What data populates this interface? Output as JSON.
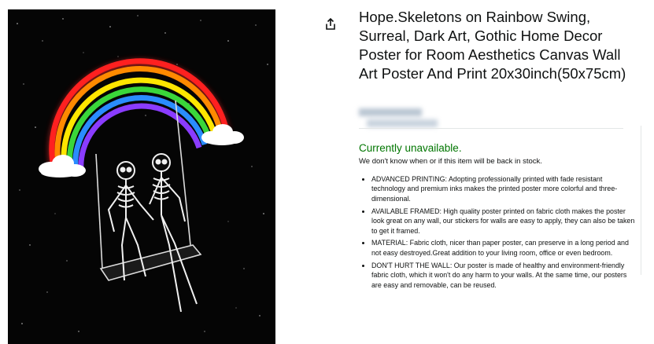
{
  "product": {
    "title": "Hope.Skeletons on Rainbow Swing, Surreal, Dark Art, Gothic Home Decor Poster for Room Aesthetics Canvas Wall Art Poster And Print 20x30inch(50x75cm)",
    "image_alt": "Skeletons on rainbow swing poster"
  },
  "share": {
    "icon": "share-icon"
  },
  "availability": {
    "status": "Currently unavailable.",
    "note": "We don't know when or if this item will be back in stock."
  },
  "features": [
    "ADVANCED PRINTING: Adopting professionally printed with fade resistant technology and premium inks makes the printed poster more colorful and three-dimensional.",
    "AVAILABLE FRAMED: High quality poster printed on fabric cloth makes the poster look great on any wall, our stickers for walls are easy to apply, they can also be taken to get it framed.",
    "MATERIAL: Fabric cloth, nicer than paper poster, can preserve in a long period and not easy destroyed.Great addition to your living room, office or even bedroom.",
    "DON'T HURT THE WALL: Our poster is made of healthy and environment-friendly fabric cloth, which it won't do any harm to your walls. At the same time, our posters are easy and removable, can be reused."
  ],
  "colors": {
    "availability": "#007600",
    "text": "#0f1111"
  }
}
